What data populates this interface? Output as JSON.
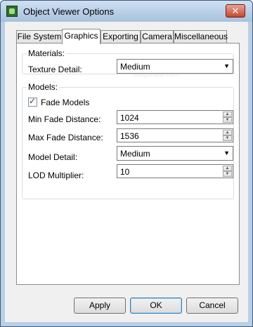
{
  "window": {
    "title": "Object Viewer Options",
    "close_glyph": "✕"
  },
  "tabs": [
    {
      "label": "File System"
    },
    {
      "label": "Graphics",
      "active": true
    },
    {
      "label": "Exporting"
    },
    {
      "label": "Camera"
    },
    {
      "label": "Miscellaneous"
    }
  ],
  "watermark": "softpedia.com",
  "materials": {
    "title": "Materials:",
    "texture_detail_label": "Texture Detail:",
    "texture_detail_value": "Medium"
  },
  "models": {
    "title": "Models:",
    "fade_models_label": "Fade Models",
    "fade_models_checked": true,
    "min_fade_label": "Min Fade Distance:",
    "min_fade_value": "1024",
    "max_fade_label": "Max Fade Distance:",
    "max_fade_value": "1536",
    "model_detail_label": "Model Detail:",
    "model_detail_value": "Medium",
    "lod_label": "LOD Multiplier:",
    "lod_value": "10"
  },
  "buttons": {
    "apply": "Apply",
    "ok": "OK",
    "cancel": "Cancel"
  },
  "icons": {
    "app": "object-viewer-app-icon",
    "close": "close-icon",
    "dropdown": "chevron-down-icon",
    "spin_up": "spin-up-icon",
    "spin_down": "spin-down-icon",
    "check": "checkmark-icon"
  }
}
